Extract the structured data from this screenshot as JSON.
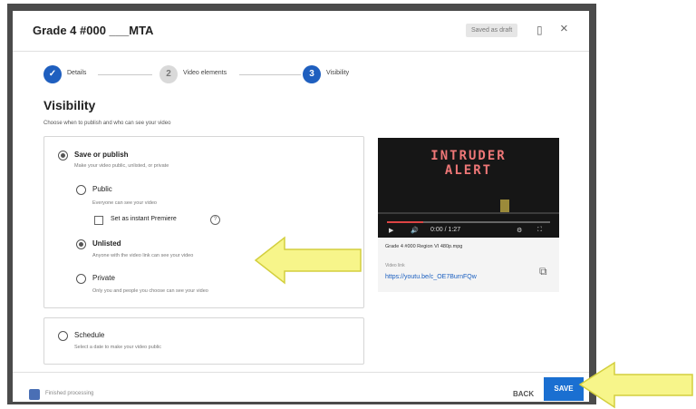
{
  "dialog": {
    "title": "Grade 4 #000 ___MTA",
    "draft_badge": "Saved as draft",
    "close_glyph": "×",
    "feedback_glyph": "▯"
  },
  "stepper": {
    "steps": [
      {
        "label": "Details",
        "glyph": "✓",
        "state": "done"
      },
      {
        "label": "Video elements",
        "glyph": "2",
        "state": "inactive"
      },
      {
        "label": "Visibility",
        "glyph": "3",
        "state": "active"
      }
    ]
  },
  "visibility": {
    "heading": "Visibility",
    "subtitle": "Choose when to publish and who can see your video",
    "save_or_publish": {
      "label": "Save or publish",
      "desc": "Make your video public, unlisted, or private",
      "selected": true
    },
    "options": [
      {
        "label": "Public",
        "desc": "Everyone can see your video",
        "selected": false
      },
      {
        "label": "Unlisted",
        "desc": "Anyone with the video link can see your video",
        "selected": true
      },
      {
        "label": "Private",
        "desc": "Only you and people you choose can see your video",
        "selected": false
      }
    ],
    "premiere": {
      "label": "Set as instant Premiere",
      "checked": false,
      "help_glyph": "?"
    },
    "schedule": {
      "label": "Schedule",
      "desc": "Select a date to make your video public",
      "selected": false
    }
  },
  "video": {
    "screen_line1": "INTRUDER",
    "screen_line2": "ALERT",
    "time": "0:00 / 1:27",
    "progress": 0.22,
    "play_glyph": "▶",
    "volume_glyph": "🔊",
    "settings_glyph": "⚙",
    "fullscreen_glyph": "⛶",
    "filename": "Grade 4 #000 Region VI 480p.mpg",
    "link_label": "Video link",
    "link": "https://youtu.be/c_OE7BurnFQw",
    "copy_glyph": "⧉"
  },
  "footer": {
    "status": "Finished processing",
    "back_label": "BACK",
    "save_label": "SAVE"
  },
  "colors": {
    "accent": "#1a6fd1",
    "arrow": "#f7f58a",
    "arrow_stroke": "#d3cf3e",
    "frame": "#4b4b4b"
  }
}
